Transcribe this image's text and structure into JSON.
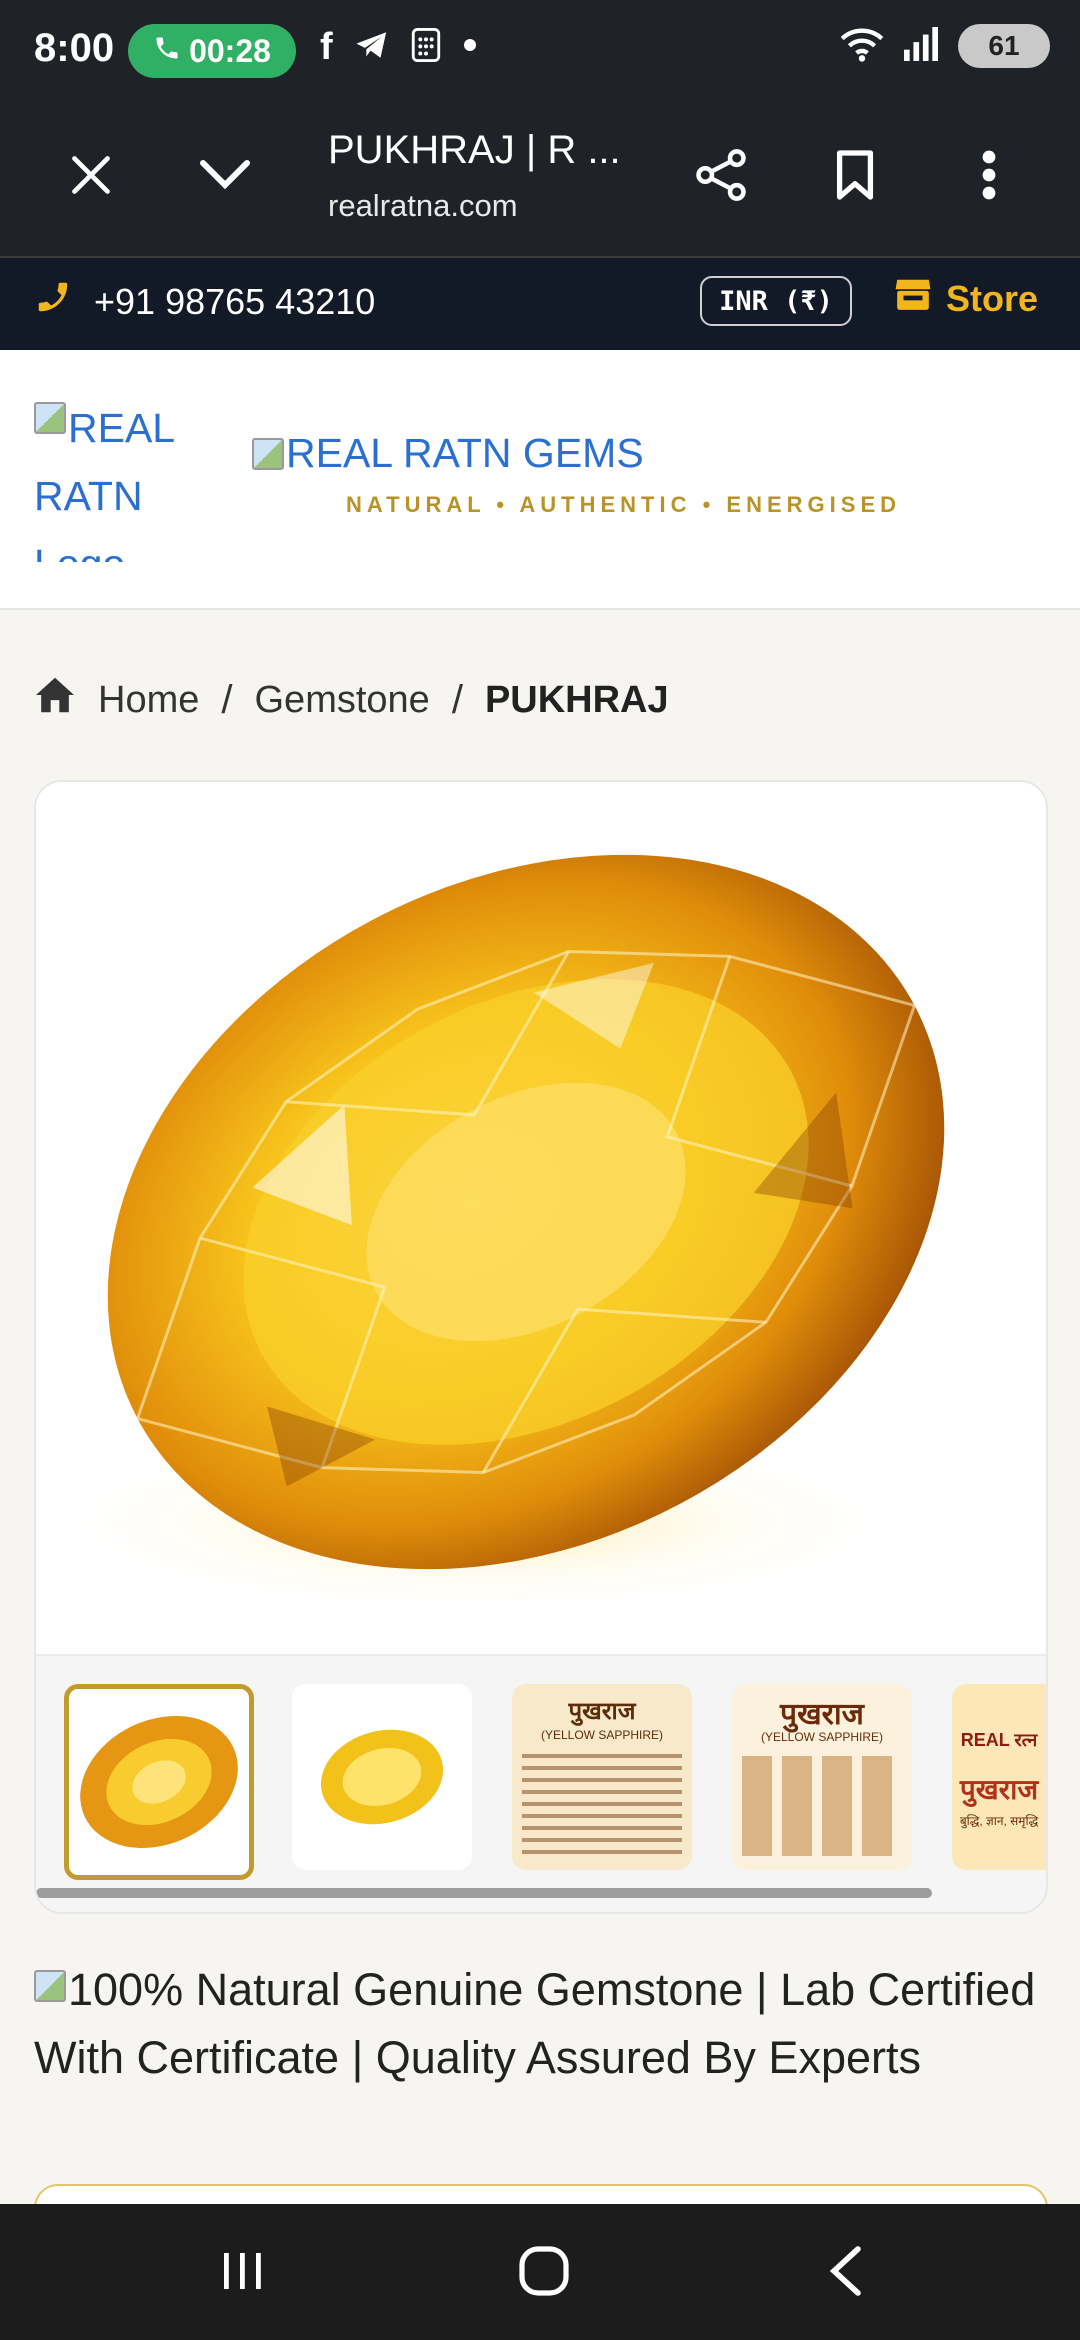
{
  "status": {
    "time": "8:00",
    "call_timer": "00:28",
    "battery": "61"
  },
  "browser": {
    "tab_title": "PUKHRAJ | R ...",
    "domain": "realratna.com"
  },
  "topbar": {
    "phone": "+91 98765 43210",
    "currency": "INR (₹)",
    "store": "Store"
  },
  "header": {
    "logo_alt": "REAL RATN Logo",
    "brand_alt": "REAL RATN GEMS",
    "tagline": "NATURAL • AUTHENTIC • ENERGISED"
  },
  "breadcrumb": {
    "home": "Home",
    "category": "Gemstone",
    "current": "PUKHRAJ"
  },
  "gallery": {
    "thumbs": [
      {
        "label": "yellow sapphire oval"
      },
      {
        "label": "yellow sapphire small"
      },
      {
        "title": "पुखराज",
        "subtitle": "(YELLOW SAPPHIRE)"
      },
      {
        "title": "पुखराज",
        "subtitle": "(YELLOW SAPPHIRE)"
      },
      {
        "brand": "REAL रत्न",
        "title": "पुखराज",
        "subtitle": "बुद्धि, ज्ञान, समृद्धि"
      }
    ]
  },
  "product": {
    "badge_alt": "100% Natural Genuine Gemstone | Lab Certified With Certificate | Quality Assured By Experts"
  },
  "colors": {
    "dark_bar": "#1f2327",
    "contact_bar": "#131a27",
    "accent_gold": "#f1b51d",
    "link_blue": "#2b6fd0",
    "call_green": "#2fb065"
  }
}
